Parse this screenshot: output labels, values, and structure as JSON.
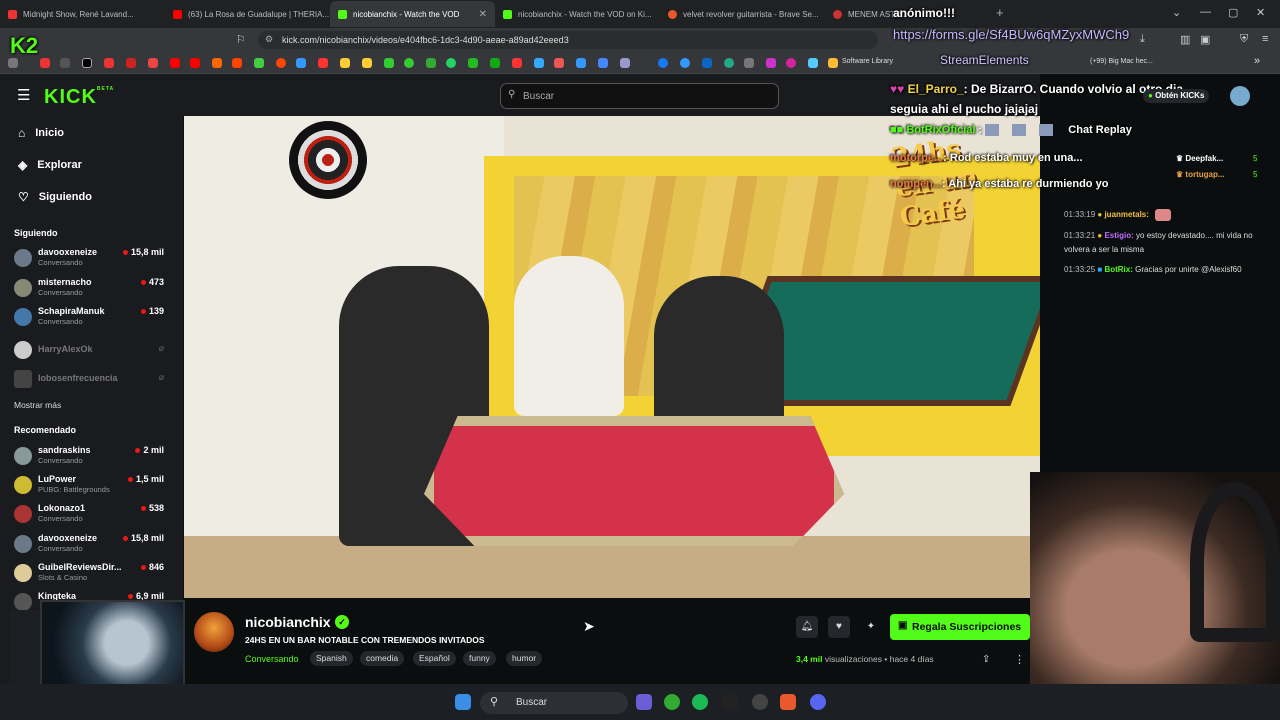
{
  "browser": {
    "tabs": [
      {
        "title": "Midnight Show, René Lavand...",
        "active": false
      },
      {
        "title": "(63) La Rosa de Guadalupe | THERIA...",
        "active": false
      },
      {
        "title": "nicobianchix - Watch the VOD",
        "active": true
      },
      {
        "title": "nicobianchix - Watch the VOD on Ki...",
        "active": false
      },
      {
        "title": "velvet revolver guitarrista - Brave Se...",
        "active": false
      },
      {
        "title": "MENEM ASTR...",
        "active": false
      }
    ],
    "url": "kick.com/nicobianchix/videos/e404fbc6-1dc3-4d90-aeae-a89ad42eeed3",
    "bookmark_labels": [
      "Software Library",
      "(+99) Big Mac hec..."
    ]
  },
  "kick": {
    "logo": "KICK",
    "logo_badge": "BETA",
    "search_placeholder": "Buscar",
    "nav": [
      {
        "label": "Inicio",
        "icon": "home-icon"
      },
      {
        "label": "Explorar",
        "icon": "compass-icon"
      },
      {
        "label": "Siguiendo",
        "icon": "heart-icon"
      }
    ],
    "following_header": "Siguiendo",
    "following": [
      {
        "name": "davooxeneize",
        "category": "Conversando",
        "viewers": "15,8 mil",
        "online": true
      },
      {
        "name": "misternacho",
        "category": "Conversando",
        "viewers": "473",
        "online": true
      },
      {
        "name": "SchapiraManuk",
        "category": "Conversando",
        "viewers": "139",
        "online": true
      },
      {
        "name": "HarryAlexOk",
        "category": "",
        "viewers": "",
        "online": false
      },
      {
        "name": "lobosenfrecuencia",
        "category": "",
        "viewers": "",
        "online": false
      }
    ],
    "show_more": "Mostrar más",
    "recommended_header": "Recomendado",
    "recommended": [
      {
        "name": "sandraskins",
        "category": "Conversando",
        "viewers": "2 mil"
      },
      {
        "name": "LuPower",
        "category": "PUBG: Battlegrounds",
        "viewers": "1,5 mil"
      },
      {
        "name": "Lokonazo1",
        "category": "Conversando",
        "viewers": "538"
      },
      {
        "name": "davooxeneize",
        "category": "Conversando",
        "viewers": "15,8 mil"
      },
      {
        "name": "GuibelReviewsDir...",
        "category": "Slots & Casino",
        "viewers": "846"
      },
      {
        "name": "Kingteka",
        "category": "",
        "viewers": "6,9 mil"
      }
    ],
    "stream": {
      "channel": "nicobianchix",
      "title": "24HS EN UN BAR NOTABLE CON TREMENDOS INVITADOS",
      "category": "Conversando",
      "tags": [
        "Spanish",
        "comedia",
        "Español",
        "funny",
        "humor"
      ],
      "subscribe_label": "Regala Suscripciones",
      "views_count": "3,4 mil",
      "views_label": "visualizaciones",
      "age": "hace 4 días"
    },
    "chat": {
      "get_kicks": "Obtén KICKs",
      "messages": [
        {
          "time": "01:33:19",
          "user": "juanmetals:",
          "text": "",
          "color": "#f0c040"
        },
        {
          "time": "01:33:21",
          "user": "Estigio:",
          "text": "yo estoy devastado.... mi vida no volvera a ser la misma",
          "color": "#c06cff"
        },
        {
          "time": "01:33:25",
          "user": "BotRix:",
          "text": "Gracias por unirte @Alexisf60",
          "color": "#53fc18"
        }
      ],
      "leaderboard": [
        {
          "name": "Deepfak...",
          "count": "5"
        },
        {
          "name": "tortugap...",
          "count": "5"
        }
      ]
    }
  },
  "overlay": {
    "url": "https://forms.gle/Sf4BUw6qMZyxMWCh9",
    "anon": "anónimo!!!",
    "stream_elements": "StreamElements",
    "msg1_user": "El_Parro_",
    "msg1_text": ": De BizarrO. Cuando volvio al otro dia seguia ahi el pucho jajajaj",
    "msg2_user": "BotRixOficial",
    "msg2_text": "Chat Replay",
    "msg3_user": "motorpe...",
    "msg3_text": ": Rod estaba muy en una...",
    "msg4_user": "nompen...",
    "msg4_text": ": Ahi ya estaba re durmiendo yo",
    "logo_text": "24hs en un Café"
  },
  "taskbar": {
    "search_label": "Buscar"
  },
  "colors": {
    "kick_green": "#53fc18",
    "live_red": "#e91916",
    "bg": "#0b0e0f"
  }
}
